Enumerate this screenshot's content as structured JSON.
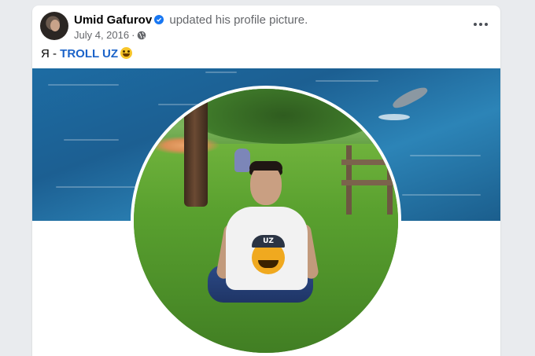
{
  "post": {
    "author": "Umid Gafurov",
    "action": "updated his profile picture.",
    "date": "July 4, 2016",
    "separator": "·",
    "caption_prefix": "Я - ",
    "caption_link": "TROLL UZ",
    "caption_emoji": "grinning-face-emoji",
    "shirt_cap_text": "UZ"
  },
  "icons": {
    "verified": "verified-badge-icon",
    "audience": "globe-icon",
    "more": "more-options-icon"
  },
  "colors": {
    "verified": "#1877f2",
    "link": "#1b63c9",
    "meta": "#65676b"
  }
}
